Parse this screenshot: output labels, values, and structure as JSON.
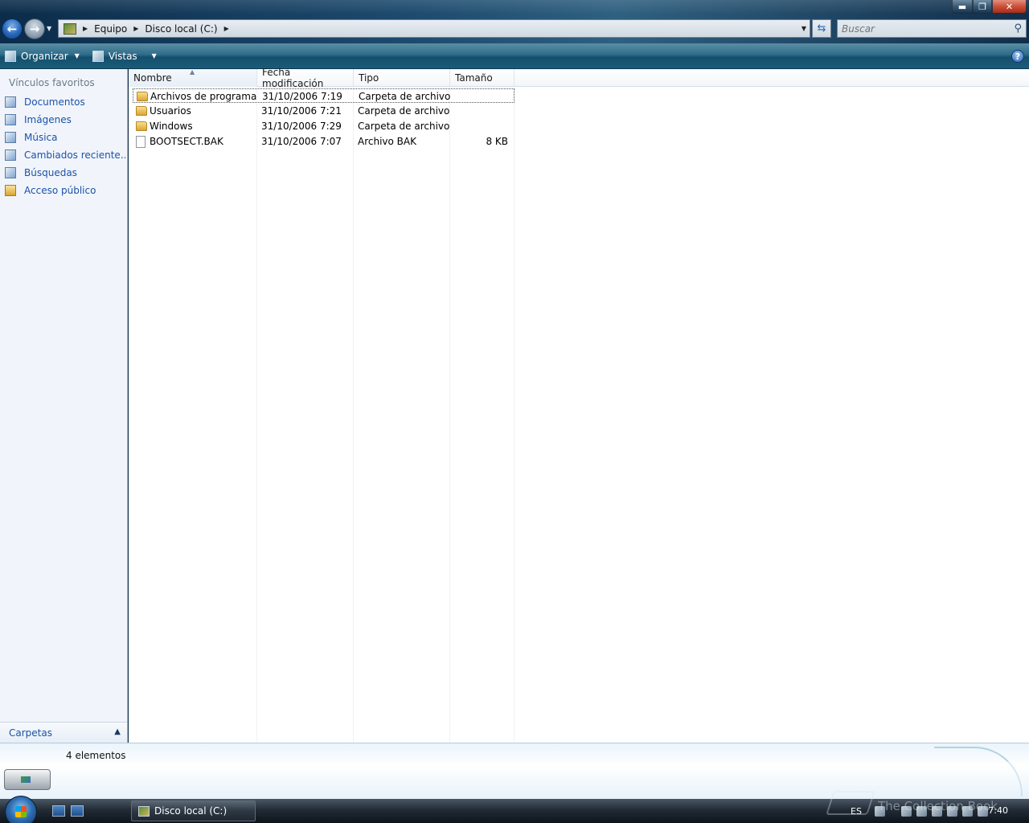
{
  "window": {
    "minimize_label": "▬",
    "maximize_label": "❐",
    "close_label": "✕"
  },
  "address_bar": {
    "crumbs": [
      "Equipo",
      "Disco local (C:)"
    ],
    "search_placeholder": "Buscar"
  },
  "command_bar": {
    "organize_label": "Organizar",
    "views_label": "Vistas",
    "help_label": "?"
  },
  "nav_pane": {
    "favorites_title": "Vínculos favoritos",
    "favorites": [
      {
        "label": "Documentos",
        "icon": "documents-icon"
      },
      {
        "label": "Imágenes",
        "icon": "pictures-icon"
      },
      {
        "label": "Música",
        "icon": "music-icon"
      },
      {
        "label": "Cambiados reciente...",
        "icon": "recent-icon"
      },
      {
        "label": "Búsquedas",
        "icon": "searches-icon"
      },
      {
        "label": "Acceso público",
        "icon": "folder-icon"
      }
    ],
    "folders_label": "Carpetas"
  },
  "file_list": {
    "columns": [
      "Nombre",
      "Fecha modificación",
      "Tipo",
      "Tamaño"
    ],
    "rows": [
      {
        "name": "Archivos de programa",
        "date": "31/10/2006 7:19",
        "type": "Carpeta de archivos",
        "size": "",
        "icon": "folder-icon"
      },
      {
        "name": "Usuarios",
        "date": "31/10/2006 7:21",
        "type": "Carpeta de archivos",
        "size": "",
        "icon": "folder-icon"
      },
      {
        "name": "Windows",
        "date": "31/10/2006 7:29",
        "type": "Carpeta de archivos",
        "size": "",
        "icon": "folder-icon"
      },
      {
        "name": "BOOTSECT.BAK",
        "date": "31/10/2006 7:07",
        "type": "Archivo BAK",
        "size": "8 KB",
        "icon": "file-icon"
      }
    ]
  },
  "details_pane": {
    "item_count": "4 elementos"
  },
  "taskbar": {
    "active_window": "Disco local (C:)",
    "language": "ES",
    "clock": "7:40",
    "watermark": "The Collection Book"
  }
}
